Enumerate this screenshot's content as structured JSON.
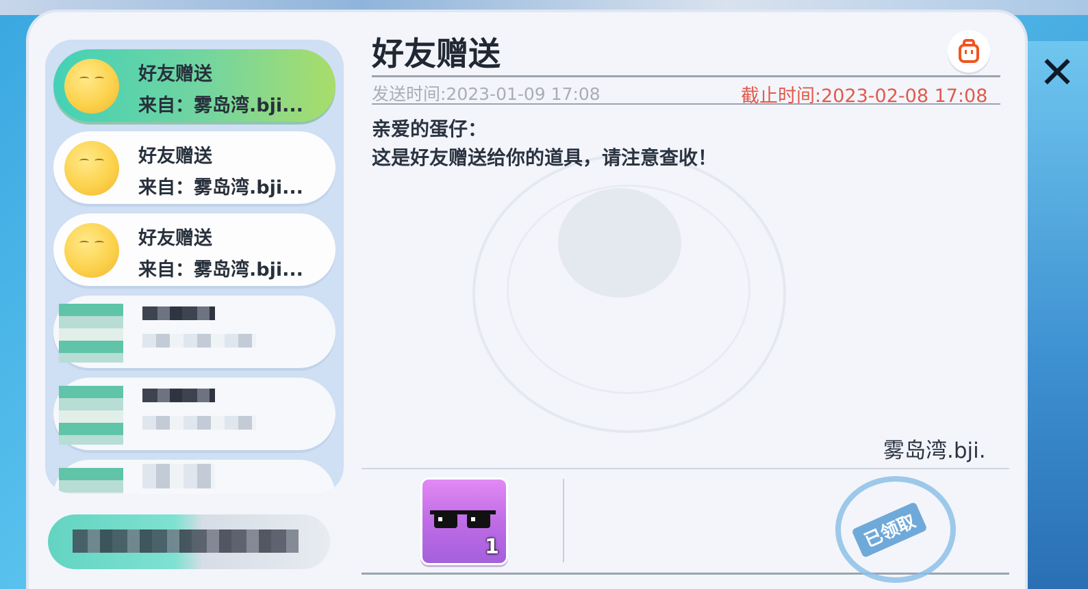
{
  "window": {
    "close_glyph": "✕"
  },
  "sidebar": {
    "items": [
      {
        "title": "好友赠送",
        "from": "来自：雾岛湾.bji...",
        "active": true
      },
      {
        "title": "好友赠送",
        "from": "来自：雾岛湾.bji...",
        "active": false
      },
      {
        "title": "好友赠送",
        "from": "来自：雾岛湾.bji...",
        "active": false
      }
    ]
  },
  "detail": {
    "title": "好友赠送",
    "send_time": "发送时间:2023-01-09 17:08",
    "deadline": "截止时间:2023-02-08 17:08",
    "greeting": "亲爱的蛋仔：",
    "body": "这是好友赠送给你的道具，请注意查收！",
    "signature": "雾岛湾.bji."
  },
  "attachments": [
    {
      "icon": "sunglasses-icon",
      "count": "1"
    }
  ],
  "stamp": {
    "label": "已领取"
  },
  "colors": {
    "accent_green": "#74d59f",
    "deadline_red": "#e05a4b",
    "item_purple": "#bf6ce6"
  }
}
